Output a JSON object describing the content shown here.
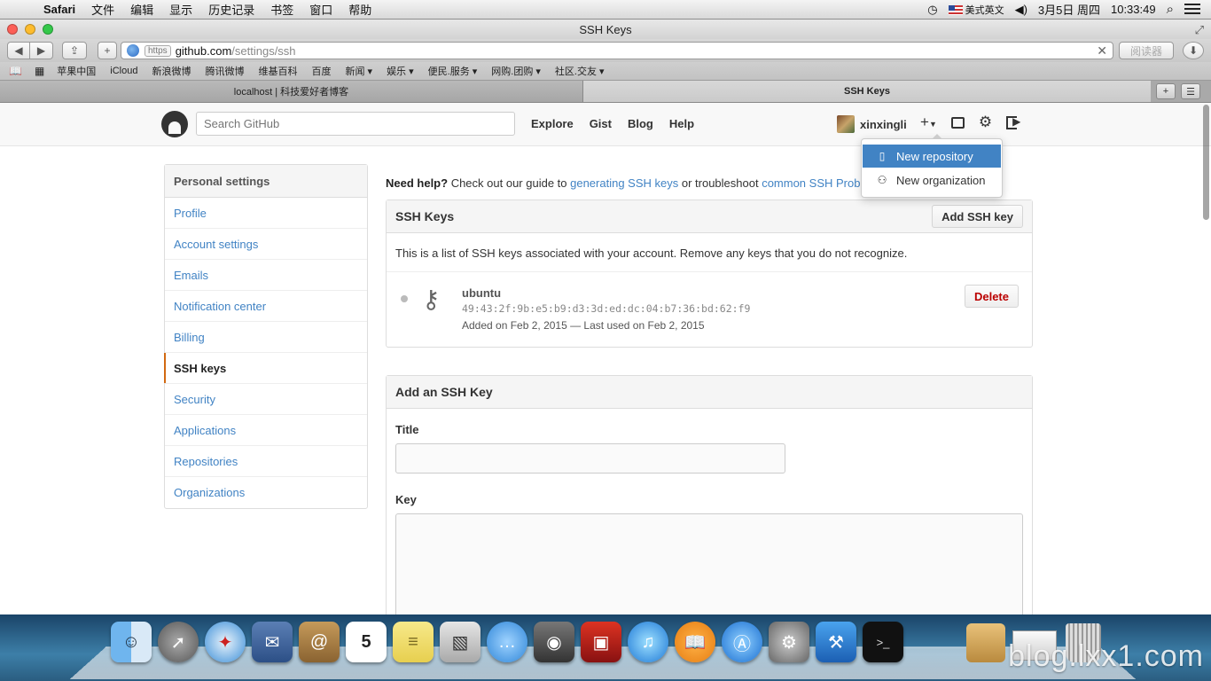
{
  "menubar": {
    "app": "Safari",
    "items": [
      "文件",
      "编辑",
      "显示",
      "历史记录",
      "书签",
      "窗口",
      "帮助"
    ],
    "input_method": "美式英文",
    "date": "3月5日 周四",
    "time": "10:33:49"
  },
  "window": {
    "title": "SSH Keys"
  },
  "toolbar": {
    "url_scheme_badge": "https",
    "url_host": "github.com",
    "url_path": "/settings/ssh",
    "reader": "阅读器"
  },
  "bookmarks": [
    "苹果中国",
    "iCloud",
    "新浪微博",
    "腾讯微博",
    "维基百科",
    "百度",
    "新闻 ▾",
    "娱乐 ▾",
    "便民.服务 ▾",
    "网购.团购 ▾",
    "社区.交友 ▾"
  ],
  "tabs": [
    {
      "label": "localhost | 科技爱好者博客"
    },
    {
      "label": "SSH Keys"
    }
  ],
  "github": {
    "search_placeholder": "Search GitHub",
    "nav": [
      "Explore",
      "Gist",
      "Blog",
      "Help"
    ],
    "username": "xinxingli",
    "dropdown": [
      {
        "label": "New repository",
        "icon": "repo-icon",
        "selected": true
      },
      {
        "label": "New organization",
        "icon": "organization-icon",
        "selected": false
      }
    ]
  },
  "sidebar": {
    "heading": "Personal settings",
    "items": [
      {
        "label": "Profile"
      },
      {
        "label": "Account settings"
      },
      {
        "label": "Emails"
      },
      {
        "label": "Notification center"
      },
      {
        "label": "Billing"
      },
      {
        "label": "SSH keys",
        "current": true
      },
      {
        "label": "Security"
      },
      {
        "label": "Applications"
      },
      {
        "label": "Repositories"
      },
      {
        "label": "Organizations"
      }
    ]
  },
  "help": {
    "lead": "Need help?",
    "text1": " Check out our guide to ",
    "link1": "generating SSH keys",
    "text2": " or troubleshoot ",
    "link2": "common SSH Probl"
  },
  "ssh_keys": {
    "title": "SSH Keys",
    "add_button": "Add SSH key",
    "description": "This is a list of SSH keys associated with your account. Remove any keys that you do not recognize.",
    "keys": [
      {
        "name": "ubuntu",
        "fingerprint": "49:43:2f:9b:e5:b9:d3:3d:ed:dc:04:b7:36:bd:62:f9",
        "added": "Added on Feb 2, 2015 — Last used on Feb 2, 2015",
        "delete_label": "Delete"
      }
    ]
  },
  "add_key": {
    "title": "Add an SSH Key",
    "title_label": "Title",
    "key_label": "Key"
  },
  "dock": {
    "watermark": "blog.lxx1.com"
  },
  "colors": {
    "link": "#4183c4",
    "selected": "#4183c4",
    "current_marker": "#d26911",
    "danger": "#bb0000"
  }
}
